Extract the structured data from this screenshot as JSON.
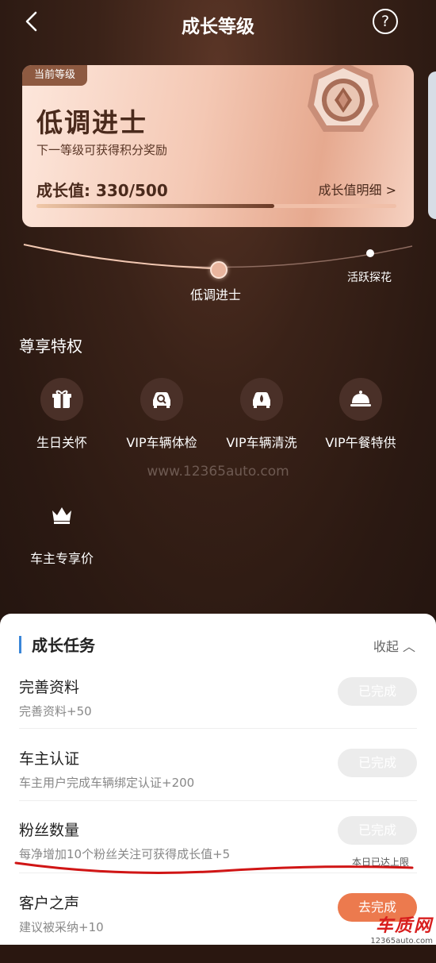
{
  "header": {
    "title": "成长等级",
    "back_icon": "chevron-left-icon",
    "help_icon": "question-icon",
    "help_glyph": "?"
  },
  "level_card": {
    "tag": "当前等级",
    "level_name": "低调进士",
    "subtitle": "下一等级可获得积分奖励",
    "growth_value": "成长值: 330/500",
    "growth_detail": "成长值明细 >",
    "progress": 0.66,
    "medal_icon": "medal-icon"
  },
  "level_track": {
    "current": "低调进士",
    "next": "活跃探花"
  },
  "privileges": {
    "title": "尊享特权",
    "items": [
      {
        "label": "生日关怀",
        "icon": "gift-icon"
      },
      {
        "label": "VIP车辆体检",
        "icon": "car-inspect-icon"
      },
      {
        "label": "VIP车辆清洗",
        "icon": "car-wash-icon"
      },
      {
        "label": "VIP午餐特供",
        "icon": "dish-cover-icon"
      },
      {
        "label": "车主专享价",
        "icon": "crown-icon"
      }
    ]
  },
  "watermark": "www.12365auto.com",
  "tasks": {
    "title": "成长任务",
    "collapse": "收起 ︿",
    "items": [
      {
        "name": "完善资料",
        "desc": "完善资料+50",
        "button": "已完成",
        "note": ""
      },
      {
        "name": "车主认证",
        "desc": "车主用户完成车辆绑定认证+200",
        "button": "已完成",
        "note": ""
      },
      {
        "name": "粉丝数量",
        "desc": "每净增加10个粉丝关注可获得成长值+5",
        "button": "已完成",
        "note": "本日已达上限"
      },
      {
        "name": "客户之声",
        "desc": "建议被采纳+10",
        "button": "去完成",
        "note": ""
      }
    ]
  },
  "corner_logo": {
    "line1": "车质网",
    "line2": "12365auto.com"
  },
  "colors": {
    "accent_orange": "#ec7a4e",
    "title_bar_blue": "#3a86d8",
    "underline_red": "#d01515"
  }
}
